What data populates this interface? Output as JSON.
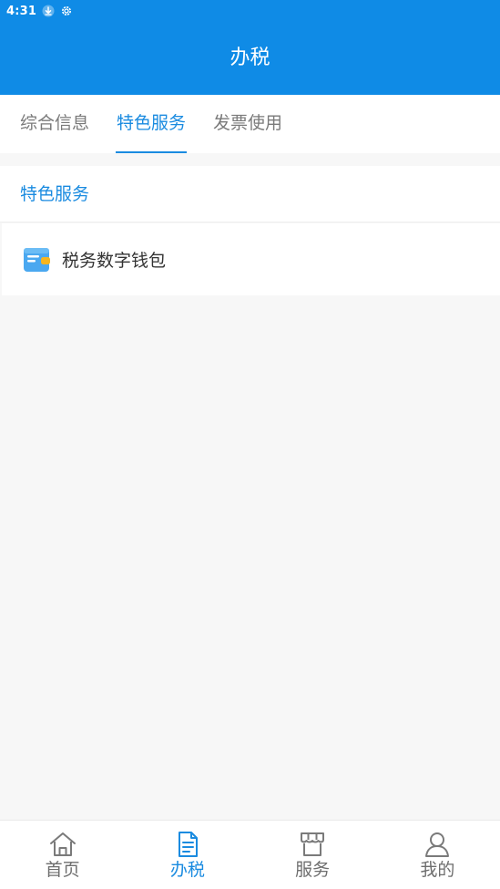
{
  "status_bar": {
    "time": "4:31",
    "icons": [
      "download-icon",
      "settings-icon"
    ]
  },
  "app_bar": {
    "title": "办税"
  },
  "tabs": [
    {
      "label": "综合信息",
      "active": false
    },
    {
      "label": "特色服务",
      "active": true
    },
    {
      "label": "发票使用",
      "active": false
    }
  ],
  "section": {
    "title": "特色服务",
    "items": [
      {
        "label": "税务数字钱包",
        "icon": "wallet-icon"
      }
    ]
  },
  "bottom_nav": [
    {
      "label": "首页",
      "icon": "home-icon",
      "active": false
    },
    {
      "label": "办税",
      "icon": "document-icon",
      "active": true
    },
    {
      "label": "服务",
      "icon": "store-icon",
      "active": false
    },
    {
      "label": "我的",
      "icon": "user-icon",
      "active": false
    }
  ],
  "colors": {
    "primary": "#0f8be6",
    "accent_text": "#1a8be0",
    "background": "#f7f7f7"
  }
}
